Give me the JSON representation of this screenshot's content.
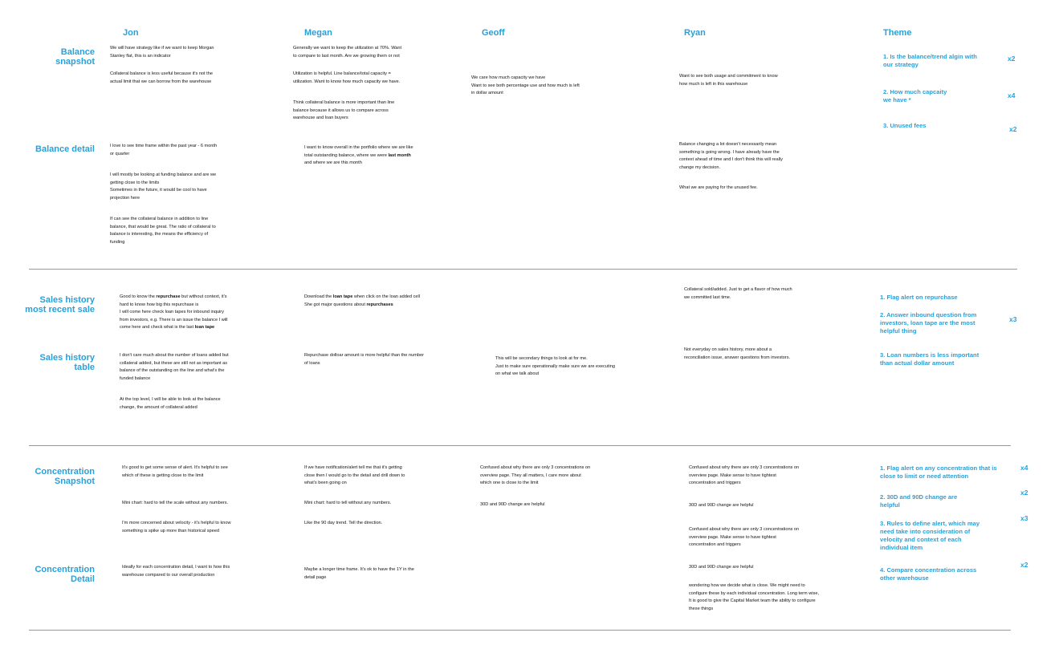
{
  "columns": [
    "Jon",
    "Megan",
    "Geoff",
    "Ryan",
    "Theme"
  ],
  "sections": {
    "balance_snapshot": "Balance\nsnapshot",
    "balance_detail": "Balance  detail",
    "sales_history_recent": "Sales history\nmost recent sale",
    "sales_history_table": "Sales history\ntable",
    "concentration_snapshot": "Concentration\nSnapshot",
    "concentration_detail": "Concentration\nDetail"
  },
  "notes": {
    "jon_bs_1a": "We will have strategy like if we want to keep Morgan",
    "jon_bs_1b": "Stanley flat, this is an indicator",
    "jon_bs_2a": "Collateral balance is less useful because it's not the",
    "jon_bs_2b": "actual limit that we can borrow from the warehouse",
    "megan_bs_1a": "Generally we want to keep the utilization at 70%. Want",
    "megan_bs_1b": "to compare to last month. Are we growing them or not",
    "megan_bs_2a": "Utilization is helpful. Line balance/total capacity =",
    "megan_bs_2b": "utilization. Want to know how much capacity we have.",
    "megan_bs_3a": "Think collateral balance is more important than line",
    "megan_bs_3b": "balance because it allows us to compare across",
    "megan_bs_3c": "warehouse and loan buyers",
    "geoff_bs_1a": "We care how much capacity we have",
    "geoff_bs_1b": "Want to see both percentage use and how much is left",
    "geoff_bs_1c": "in dollar amount",
    "ryan_bs_1a": "Want to see both usage and commitment to know",
    "ryan_bs_1b": "how much is left in this warehouse",
    "jon_bd_1a": "I love to see time frame within the past year - 6 month",
    "jon_bd_1b": "or quarter",
    "jon_bd_2a": "I will mostly be looking at funding balance and are we",
    "jon_bd_2b": "getting close to the limits",
    "jon_bd_2c": "Sometimes in the future, it would be cool to have",
    "jon_bd_2d": "projection here",
    "jon_bd_3a": "If can see the collateral balance in addition to line",
    "jon_bd_3b": "balance, that would be great.  The ratio of collateral to",
    "jon_bd_3c": "balance is interesting, the means the efficiency of",
    "jon_bd_3d": "funding",
    "megan_bd_1a": "I want to know overall in the portfolio where we are like",
    "megan_bd_1b_pre": "total outstanding balance, where we were ",
    "megan_bd_1b_bold": "last month",
    "megan_bd_1c": "and where we are this month",
    "ryan_bd_1a": "Balance changing a lot doesn't necessarily mean",
    "ryan_bd_1b": "something is going wrong. I have already have the",
    "ryan_bd_1c": "context ahead of time and I don't think this will really",
    "ryan_bd_1d": "change my decision.",
    "ryan_bd_2": "What we are paying for the unused fee.",
    "jon_sr_1a_pre": "Good to know the ",
    "jon_sr_1a_bold": "repurchase",
    "jon_sr_1a_post": " but without context, it's",
    "jon_sr_1b": "hard to know how big this repurchase is",
    "jon_sr_1c": "I will come here check loan tapes for inbound inquiry",
    "jon_sr_1d": "from investors, e.g. There is an issue the balance I will",
    "jon_sr_1e_pre": "come here and check what is the last ",
    "jon_sr_1e_bold": "loan tape",
    "megan_sr_1a_pre": "Download the ",
    "megan_sr_1a_bold": "loan tape",
    "megan_sr_1a_post": " when click on the loan added cell",
    "megan_sr_1b_pre": "She got major questions about ",
    "megan_sr_1b_bold": "repurchases",
    "ryan_sr_1a": "Collateral sold/added. Just to get a flavor of how much",
    "ryan_sr_1b": "we committed last time.",
    "jon_st_1a": "I don't care much about the number of loans added but",
    "jon_st_1b": "collateral added, but these are still not as important as",
    "jon_st_1c": "balance of the outstanding on the line and what's the",
    "jon_st_1d": "funded balance",
    "jon_st_2a": "At the top level, I will be able to look at the balance",
    "jon_st_2b": "change, the amount of collateral added",
    "megan_st_1a": "Repurchase dolloar amount is more helpful than the number",
    "megan_st_1b": "of loans",
    "geoff_st_1a": "This will be secondary things to look at for me.",
    "geoff_st_1b": "Just to make sure operationally make sure we are executing",
    "geoff_st_1c": "on what we talk about",
    "ryan_st_1a": "Not everyday on sales history, more about a",
    "ryan_st_1b": "reconciliation issue, answer questions from investors.",
    "jon_cs_1a": "It's good to get some sense of alert. It's helpful to see",
    "jon_cs_1b": "which of these is getting close to the limit",
    "jon_cs_2": "Mini chart: hard to tell the scale without any numbers.",
    "jon_cs_3a": "I'm more concerned about velocity - it's helpful to know",
    "jon_cs_3b": "something is spike up more than historical speed",
    "megan_cs_1a": "If we have notification/alert tell me that it's getting",
    "megan_cs_1b": "close then I would go to the detail and drill down to",
    "megan_cs_1c": "what's been going on",
    "megan_cs_2": "Mini chart: hard to tell without any numbers.",
    "megan_cs_3": "Like the 90 day trend. Tell the direction.",
    "geoff_cs_1a": "Confused about why there are only 3 concentrations on",
    "geoff_cs_1b": "overview page. They all matters, I care more about",
    "geoff_cs_1c": "which one is close to the limit",
    "geoff_cs_2": "30D and 90D change are helpful",
    "ryan_cs_1a": "Confused about why there are only 3 concentrations on",
    "ryan_cs_1b": "overview page. Make sense to have tightest",
    "ryan_cs_1c": "concentration and triggers",
    "ryan_cs_2": "30D and 90D change are helpful",
    "ryan_cs_3a": "Confused about why there are only 3 concentrations on",
    "ryan_cs_3b": "overview page. Make sense to have tightest",
    "ryan_cs_3c": "concentration and triggers",
    "ryan_cs_4": "30D and 90D change are helpful",
    "ryan_cs_5a": "wondering how we decide what is close. We might need to",
    "ryan_cs_5b": "configure these by each individual concentration.  Long term wise,",
    "ryan_cs_5c": "It is good to give the Capital Market team the ability to configure",
    "ryan_cs_5d": "these things",
    "jon_cd_1a": "Ideally for each concentration detail, I want to how this",
    "jon_cd_1b": "warehouse compared to our overall production",
    "megan_cd_1a": "Maybe a longer time frame. It's ok to have the 1Y in the",
    "megan_cd_1b": "detail page"
  },
  "themes": {
    "balance": [
      {
        "text": "1. Is the balance/trend algin with\nour strategy",
        "mult": "x2"
      },
      {
        "text": "2. How much capcaity\nwe have *",
        "mult": "x4"
      },
      {
        "text": "3. Unused fees",
        "mult": "x2"
      }
    ],
    "sales": [
      {
        "text": "1. Flag alert on repurchase",
        "mult": ""
      },
      {
        "text": "2. Answer inbound question from\ninvestors, loan tape are the most\nhelpful thing",
        "mult": "x3"
      },
      {
        "text": "3. Loan numbers is less important\nthan actual dollar amount",
        "mult": ""
      }
    ],
    "concentration": [
      {
        "text": "1. Flag alert on any concentration that is\nclose to limit or need attention",
        "mult": "x4"
      },
      {
        "text": "2. 30D and  90D change are\nhelpful",
        "mult": "x2"
      },
      {
        "text": "3. Rules to define alert, which may\nneed take into consideration of\nvelocity and context of each\nindividual item",
        "mult": "x3"
      },
      {
        "text": "4. Compare concentration across\nother warehouse",
        "mult": "x2"
      }
    ]
  }
}
